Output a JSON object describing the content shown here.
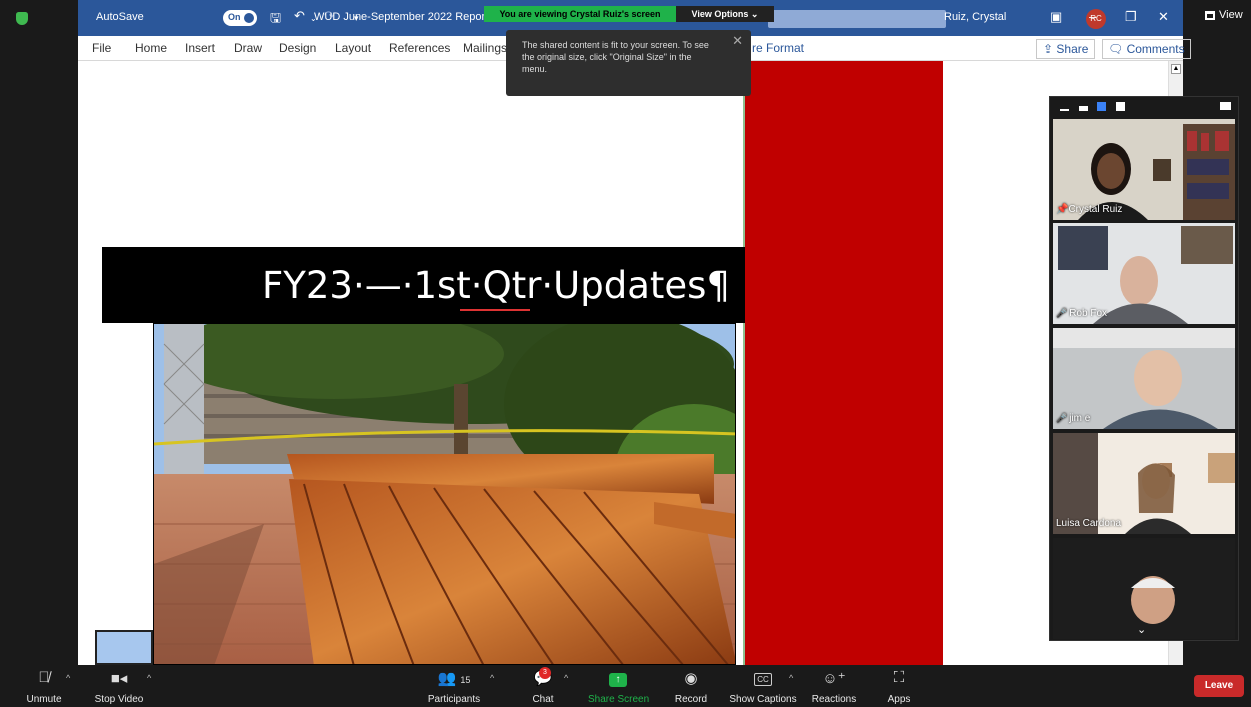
{
  "word": {
    "autosave_label": "AutoSave",
    "autosave_state": "On",
    "doc_title": "WUD June-September 2022 Report.do",
    "user_name": "Ruiz, Crystal",
    "user_initials": "RC",
    "menu": [
      "File",
      "Home",
      "Insert",
      "Draw",
      "Design",
      "Layout",
      "References",
      "Mailings"
    ],
    "picture_format_label": "re Format",
    "share_label": "Share",
    "comments_label": "Comments"
  },
  "zoom": {
    "viewing_banner": "You are viewing Crystal Ruiz's screen",
    "view_options_label": "View Options",
    "tooltip_text": "The shared content is fit to your screen. To see the original size, click \"Original Size\" in the menu.",
    "view_label": "View"
  },
  "document": {
    "heading": "FY23·—·1st·Qtr·Updates¶"
  },
  "gallery": {
    "participants": [
      {
        "name": "Crystal Ruiz",
        "muted": false
      },
      {
        "name": "Rob Fox",
        "muted": true
      },
      {
        "name": "jim e",
        "muted": true
      },
      {
        "name": "Luisa Cardona",
        "muted": false
      },
      {
        "name": "",
        "muted": false
      }
    ]
  },
  "toolbar": {
    "unmute_label": "Unmute",
    "stop_video_label": "Stop Video",
    "participants_label": "Participants",
    "participants_count": "15",
    "chat_label": "Chat",
    "chat_badge": "3",
    "share_screen_label": "Share Screen",
    "record_label": "Record",
    "captions_label": "Show Captions",
    "reactions_label": "Reactions",
    "apps_label": "Apps",
    "leave_label": "Leave"
  },
  "colors": {
    "word_blue": "#2b579a",
    "share_green": "#1fb24a",
    "leave_red": "#c92a2a",
    "doc_red": "#c00000"
  }
}
